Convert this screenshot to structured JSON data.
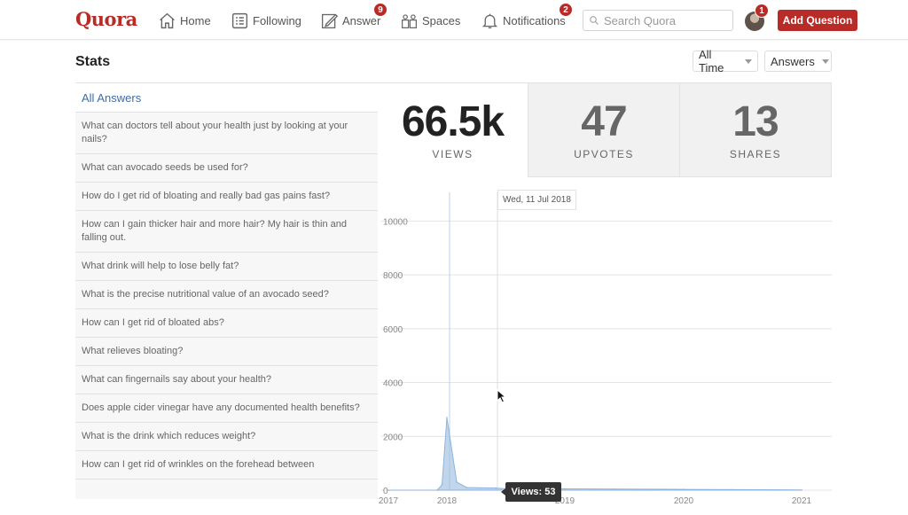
{
  "nav": {
    "logo": "Quora",
    "home": "Home",
    "following": "Following",
    "answer": "Answer",
    "answer_badge": "9",
    "spaces": "Spaces",
    "notifications": "Notifications",
    "notifications_badge": "2",
    "search_placeholder": "Search Quora",
    "avatar_badge": "1",
    "add_question": "Add Question",
    "accent_color": "#b92b27"
  },
  "stats": {
    "title": "Stats",
    "time_filter": "All Time",
    "type_filter": "Answers"
  },
  "answers": {
    "header": "All Answers",
    "items": [
      "What can doctors tell about your health just by looking at your nails?",
      "What can avocado seeds be used for?",
      "How do I get rid of bloating and really bad gas pains fast?",
      "How can I gain thicker hair and more hair? My hair is thin and falling out.",
      "What drink will help to lose belly fat?",
      "What is the precise nutritional value of an avocado seed?",
      "How can I get rid of bloated abs?",
      "What relieves bloating?",
      "What can fingernails say about your health?",
      "Does apple cider vinegar have any documented health benefits?",
      "What is the drink which reduces weight?",
      "How can I get rid of wrinkles on the forehead between"
    ]
  },
  "metrics": [
    {
      "value": "66.5k",
      "label": "VIEWS"
    },
    {
      "value": "47",
      "label": "UPVOTES"
    },
    {
      "value": "13",
      "label": "SHARES"
    }
  ],
  "chart_data": {
    "type": "area",
    "x_ticks": [
      "2017",
      "2018",
      "2019",
      "2020",
      "2021"
    ],
    "y_ticks": [
      "0",
      "2000",
      "4000",
      "6000",
      "8000",
      "10000"
    ],
    "ylim": [
      0,
      11000
    ],
    "x": [
      "2017-01",
      "2017-11",
      "2017-12",
      "2018-01",
      "2018-02",
      "2018-03",
      "2018-06",
      "2018-07",
      "2019-01",
      "2019-06",
      "2020-01",
      "2020-06",
      "2021-01"
    ],
    "values": [
      0,
      0,
      200,
      2700,
      300,
      100,
      80,
      53,
      50,
      40,
      30,
      20,
      10
    ],
    "series_color": "#a7c4e3",
    "hover_date": "Wed, 11 Jul 2018",
    "tooltip": "Views: 53"
  }
}
